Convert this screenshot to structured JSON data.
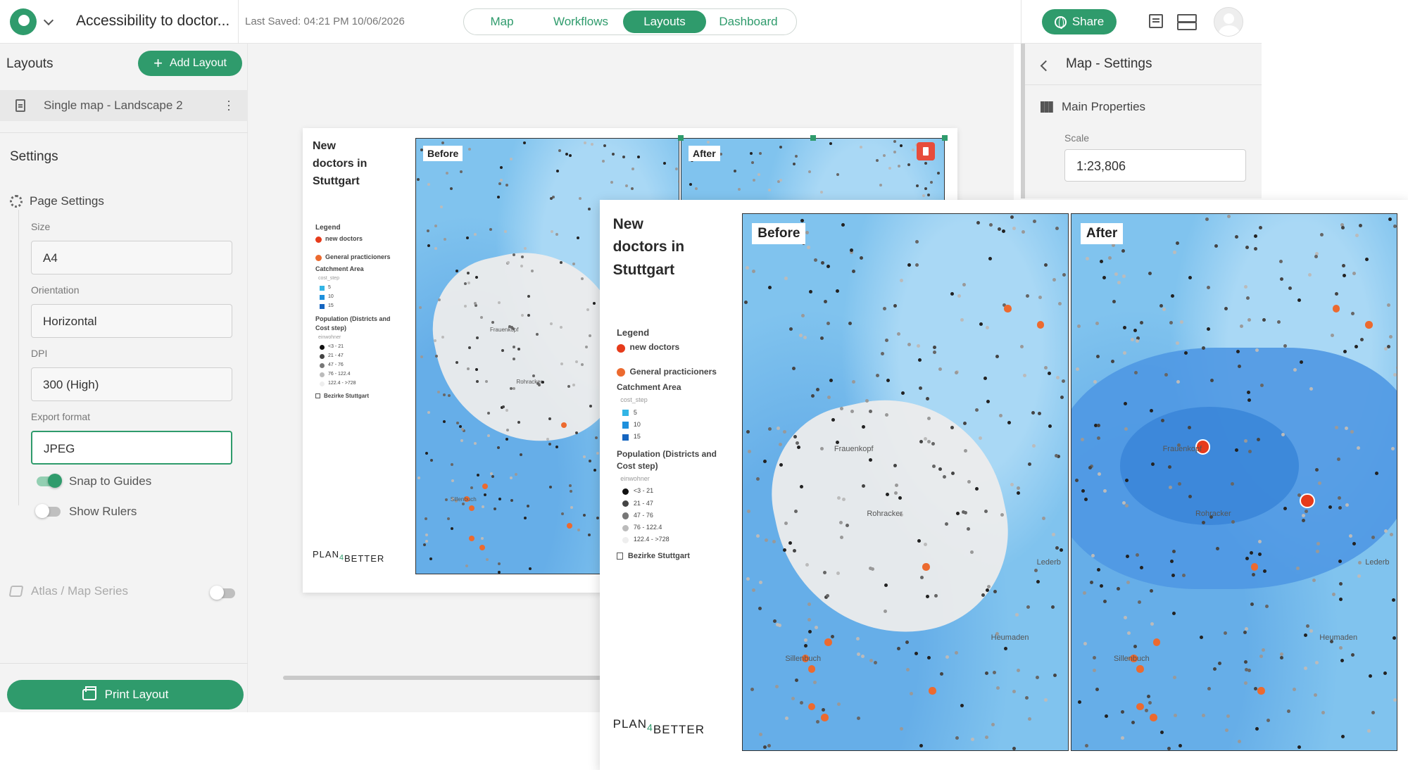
{
  "header": {
    "project_title": "Accessibility to doctor...",
    "last_saved": "Last Saved: 04:21 PM 10/06/2026",
    "tabs": [
      {
        "label": "Map",
        "active": false
      },
      {
        "label": "Workflows",
        "active": false
      },
      {
        "label": "Layouts",
        "active": true
      },
      {
        "label": "Dashboard",
        "active": false
      }
    ],
    "share_label": "Share"
  },
  "left_panel": {
    "layouts_heading": "Layouts",
    "add_layout_label": "Add Layout",
    "layout_items": [
      "Single map - Landscape 2"
    ],
    "settings_heading": "Settings",
    "page_settings_label": "Page Settings",
    "size_label": "Size",
    "size_value": "A4",
    "orientation_label": "Orientation",
    "orientation_value": "Horizontal",
    "dpi_label": "DPI",
    "dpi_value": "300 (High)",
    "export_format_label": "Export format",
    "export_format_value": "JPEG",
    "snap_to_guides_label": "Snap to Guides",
    "snap_to_guides_on": true,
    "show_rulers_label": "Show Rulers",
    "show_rulers_on": false,
    "atlas_label": "Atlas / Map Series",
    "atlas_on": false,
    "print_label": "Print Layout"
  },
  "right_panel": {
    "title": "Map - Settings",
    "main_properties_label": "Main Properties",
    "scale_label": "Scale",
    "scale_value": "1:23,806"
  },
  "layout_page": {
    "title_line1": "New",
    "title_line2": "doctors in",
    "title_line3": "Stuttgart",
    "legend_heading": "Legend",
    "legend_new_doctors": "new doctors",
    "legend_gps": "General practicioners",
    "catchment_heading": "Catchment Area",
    "catchment_field": "cost_step",
    "catchment_steps": [
      "5",
      "10",
      "15"
    ],
    "population_heading_line1": "Population (Districts and",
    "population_heading_line2": "Cost step)",
    "population_field": "einwohner",
    "population_classes": [
      "<3 - 21",
      "21 - 47",
      "47 - 76",
      "76 - 122.4",
      "122.4 - >728"
    ],
    "bezirke_label": "Bezirke Stuttgart",
    "before_label": "Before",
    "after_label": "After",
    "brand_left": "PLAN",
    "brand_four": "4",
    "brand_right": "BETTER",
    "places": [
      "Frauenkopf",
      "Rohracker",
      "Heumaden",
      "Sillenbuch",
      "Lederb"
    ]
  },
  "colors": {
    "accent": "#2f9b6c",
    "new_doctor": "#e63b1b",
    "gp": "#ec6a2f",
    "catchment_5": "#33b5e5",
    "catchment_10": "#1e90dc",
    "catchment_15": "#1565c0",
    "delete": "#e74c3c"
  }
}
